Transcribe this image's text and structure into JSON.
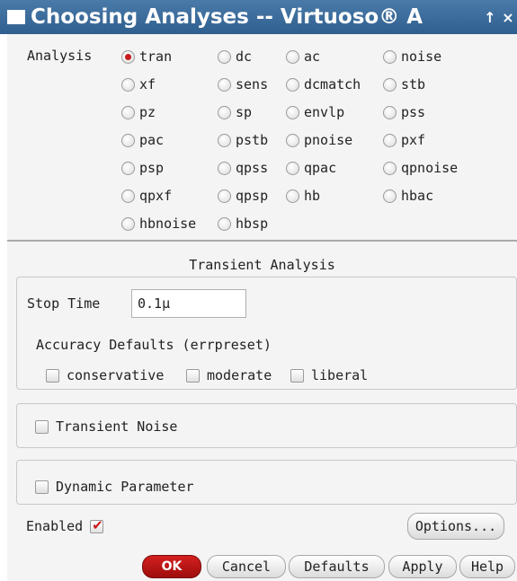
{
  "window": {
    "title": "Choosing Analyses -- Virtuoso® A",
    "title_buttons": [
      "↑",
      "×"
    ]
  },
  "analysis": {
    "label": "Analysis",
    "selected": "tran",
    "options": [
      "tran",
      "dc",
      "ac",
      "noise",
      "xf",
      "sens",
      "dcmatch",
      "stb",
      "pz",
      "sp",
      "envlp",
      "pss",
      "pac",
      "pstb",
      "pnoise",
      "pxf",
      "psp",
      "qpss",
      "qpac",
      "qpnoise",
      "qpxf",
      "qpsp",
      "hb",
      "hbac",
      "hbnoise",
      "hbsp"
    ]
  },
  "transient": {
    "section_title": "Transient Analysis",
    "stop_time_label": "Stop Time",
    "stop_time_value": "0.1μ",
    "accuracy_label": "Accuracy Defaults (errpreset)",
    "accuracy_options": [
      "conservative",
      "moderate",
      "liberal"
    ],
    "transient_noise_label": "Transient Noise",
    "dynamic_parameter_label": "Dynamic Parameter"
  },
  "footer": {
    "enabled_label": "Enabled",
    "enabled_checked": true,
    "options_button": "Options...",
    "buttons": {
      "ok": "OK",
      "cancel": "Cancel",
      "defaults": "Defaults",
      "apply": "Apply",
      "help": "Help"
    }
  }
}
